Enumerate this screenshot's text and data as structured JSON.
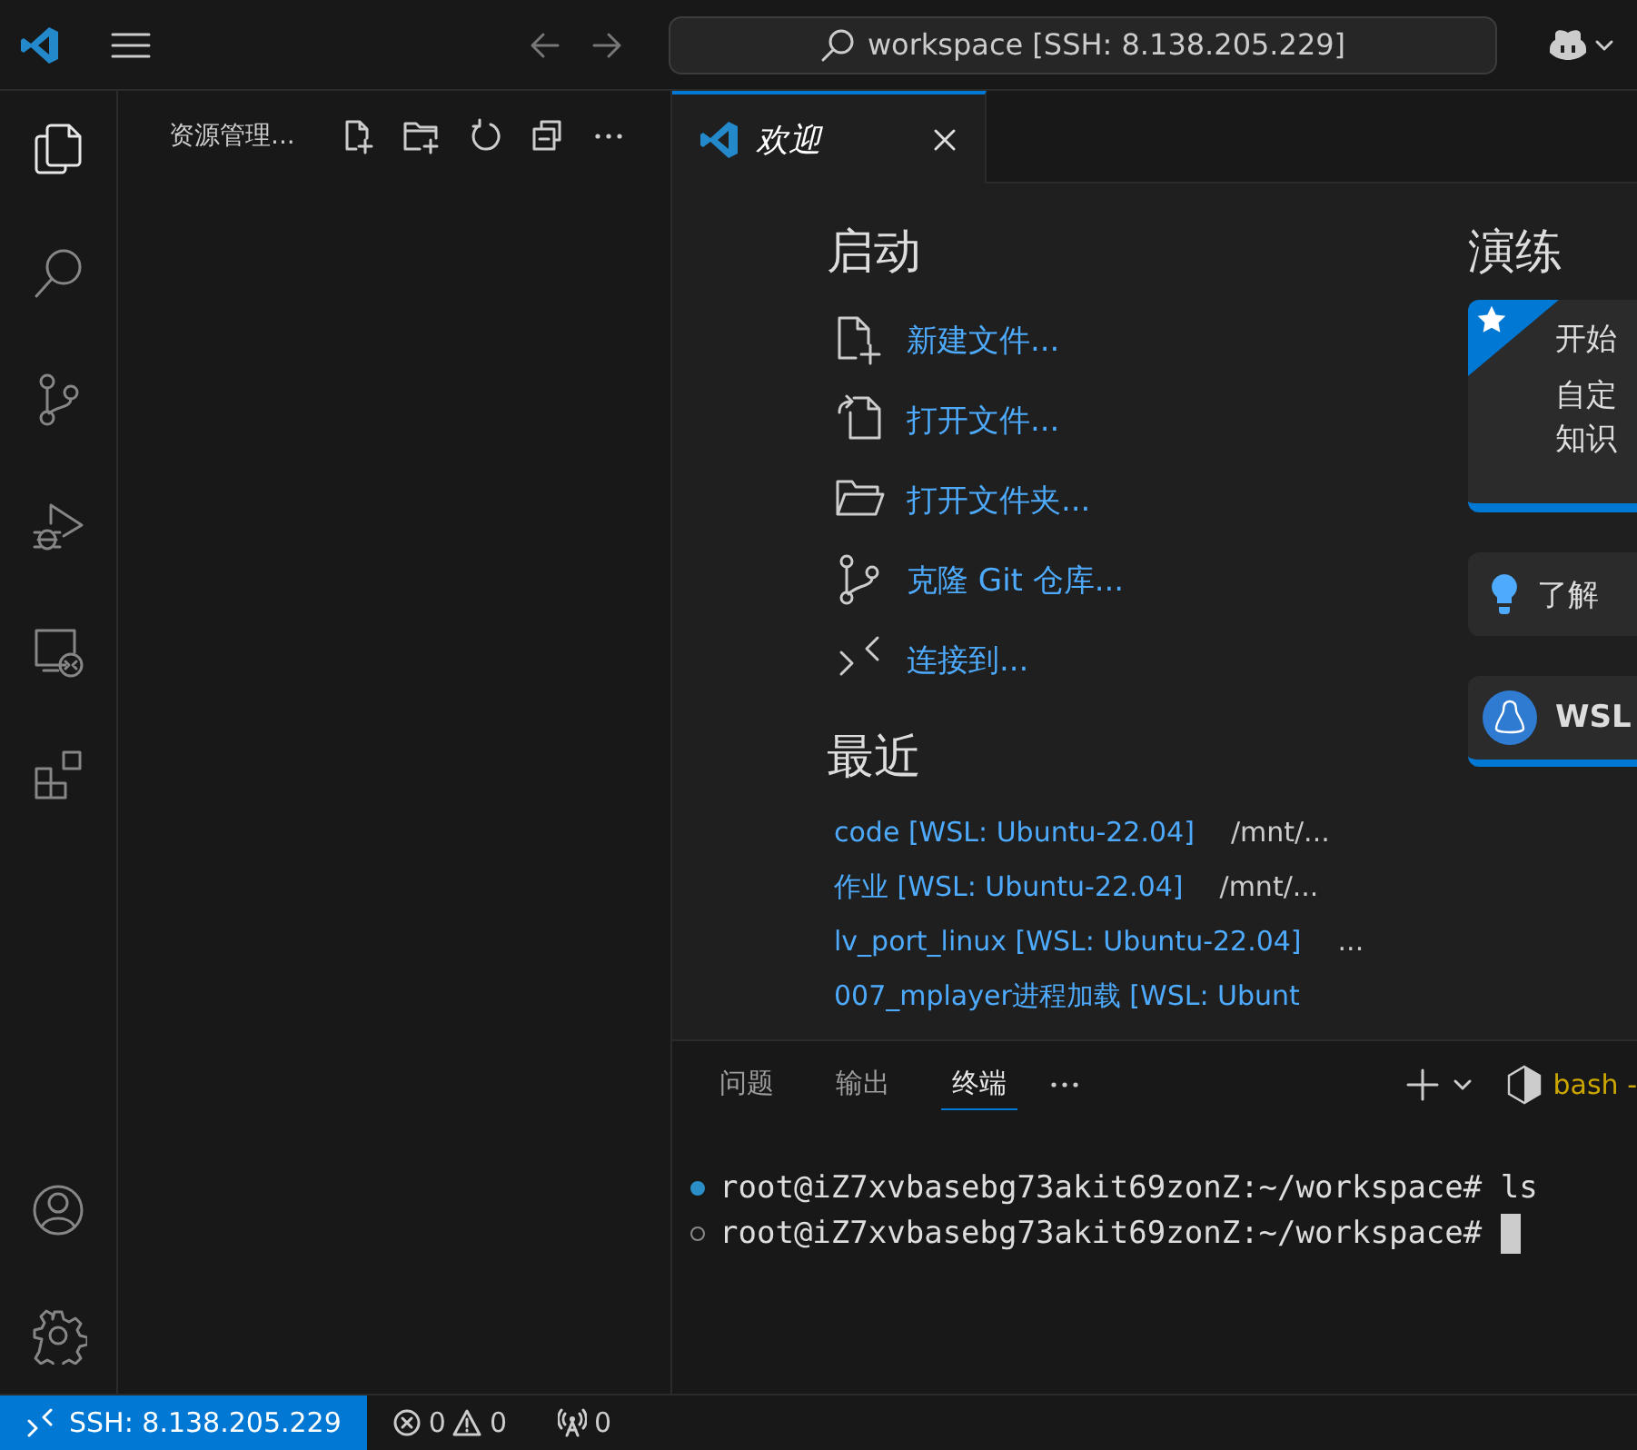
{
  "title_bar": {
    "search": "workspace [SSH: 8.138.205.229]"
  },
  "activity_bar": {
    "items": [
      {
        "kind": "explorer",
        "selected": true
      },
      {
        "kind": "search",
        "selected": false
      },
      {
        "kind": "source-control",
        "selected": false
      },
      {
        "kind": "run-debug",
        "selected": false
      },
      {
        "kind": "remote",
        "selected": false
      },
      {
        "kind": "extensions",
        "selected": false
      }
    ],
    "bottom": [
      {
        "kind": "account"
      },
      {
        "kind": "settings"
      }
    ]
  },
  "sidebar": {
    "title": "资源管理...",
    "actions": [
      {
        "kind": "new-file"
      },
      {
        "kind": "new-folder"
      },
      {
        "kind": "refresh"
      },
      {
        "kind": "collapse"
      },
      {
        "kind": "more"
      }
    ]
  },
  "tabs": [
    {
      "label": "欢迎",
      "selected": true
    }
  ],
  "welcome": {
    "start": {
      "heading": "启动",
      "items": [
        {
          "kind": "new-file",
          "label": "新建文件..."
        },
        {
          "kind": "open-file",
          "label": "打开文件..."
        },
        {
          "kind": "open-folder",
          "label": "打开文件夹..."
        },
        {
          "kind": "clone",
          "label": "克隆 Git 仓库..."
        },
        {
          "kind": "connect",
          "label": "连接到..."
        }
      ]
    },
    "recent": {
      "heading": "最近",
      "items": [
        {
          "name": "code [WSL: Ubuntu-22.04]",
          "path": "/mnt/..."
        },
        {
          "name": "作业 [WSL: Ubuntu-22.04]",
          "path": "/mnt/..."
        },
        {
          "name": "lv_port_linux [WSL: Ubuntu-22.04]",
          "path": "..."
        },
        {
          "name": "007_mplayer进程加载 [WSL: Ubunt"
        }
      ]
    },
    "walkthroughs": {
      "heading": "演练",
      "cards": [
        {
          "kind": "featured",
          "title": "开始",
          "lines": [
            "自定",
            "知识"
          ]
        },
        {
          "kind": "tip",
          "title": "了解"
        },
        {
          "kind": "wsl",
          "title": "WSL"
        }
      ]
    }
  },
  "panel": {
    "tabs": [
      {
        "label": "问题",
        "selected": false
      },
      {
        "label": "输出",
        "selected": false
      },
      {
        "label": "终端",
        "selected": true
      }
    ],
    "terminal_name": "bash -",
    "lines": [
      {
        "text": "root@iZ7xvbasebg73akit69zonZ:~/workspace# ls",
        "finished": true,
        "cursor": false
      },
      {
        "text": "root@iZ7xvbasebg73akit69zonZ:~/workspace# ",
        "finished": false,
        "cursor": true
      }
    ]
  },
  "status_bar": {
    "remote": "SSH: 8.138.205.229",
    "errors": "0",
    "warnings": "0",
    "ports": "0"
  }
}
